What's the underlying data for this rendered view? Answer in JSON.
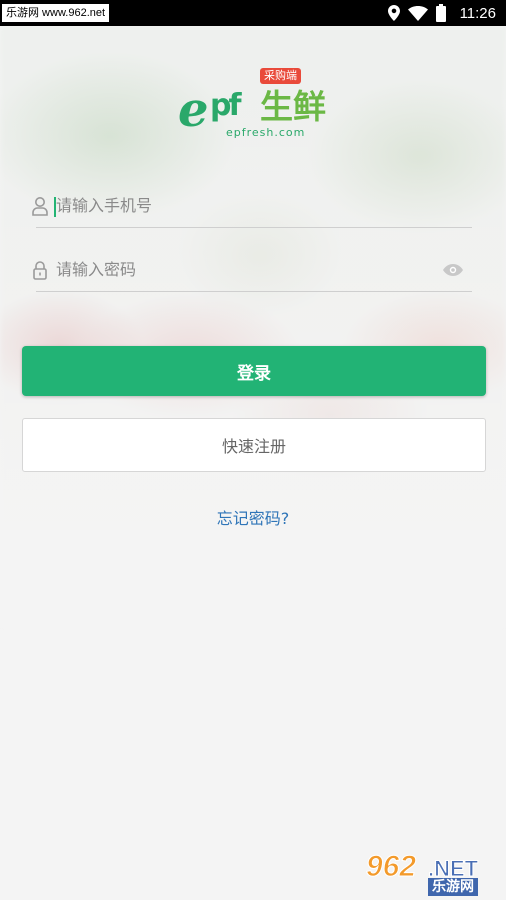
{
  "status_bar": {
    "left_label": "乐游网 www.962.net",
    "time": "11:26",
    "icons": [
      "location-icon",
      "wifi-icon",
      "battery-icon"
    ]
  },
  "logo": {
    "badge": "采购端",
    "brand_cn": "生鲜",
    "url": "epfresh.com",
    "brand_prefix": "e",
    "brand_mid": "pf"
  },
  "form": {
    "phone_placeholder": "请输入手机号",
    "password_placeholder": "请输入密码",
    "login_label": "登录",
    "register_label": "快速注册",
    "forgot_label": "忘记密码?"
  },
  "watermark": {
    "number": "962",
    "domain": ".NET",
    "cn": "乐游网"
  },
  "colors": {
    "accent": "#22b375",
    "link": "#2f75b8",
    "logo_green": "#2aa86a"
  }
}
